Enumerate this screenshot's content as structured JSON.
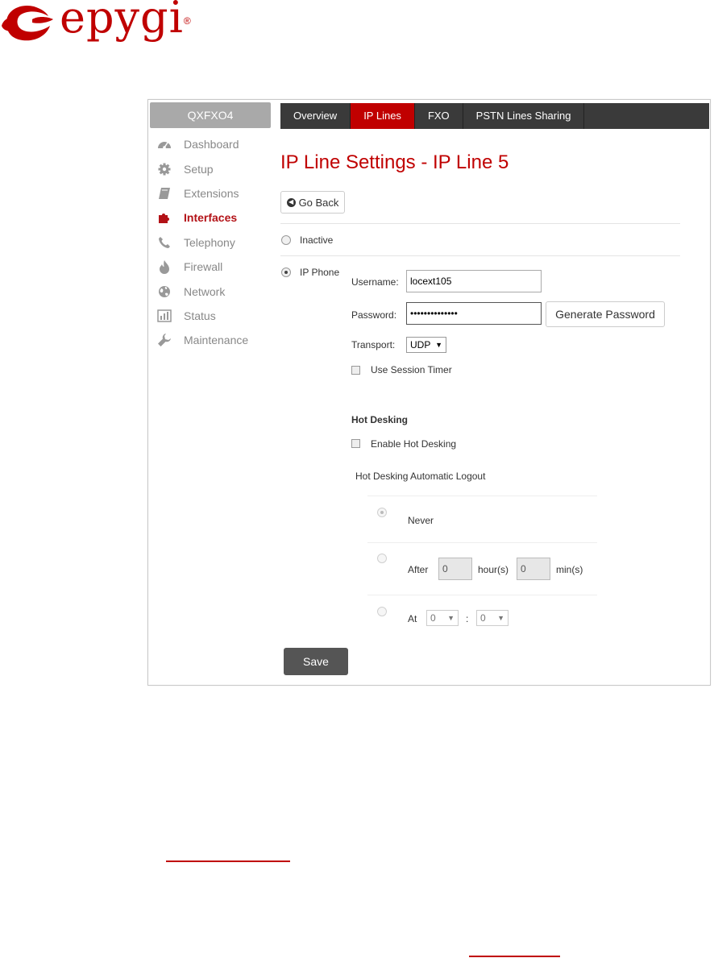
{
  "brand": {
    "name": "epygi",
    "reg": "®",
    "color": "#c00000"
  },
  "device": {
    "name": "QXFXO4"
  },
  "sidebar": {
    "items": [
      {
        "label": "Dashboard",
        "icon": "dashboard-icon"
      },
      {
        "label": "Setup",
        "icon": "gear-icon"
      },
      {
        "label": "Extensions",
        "icon": "book-icon"
      },
      {
        "label": "Interfaces",
        "icon": "puzzle-icon",
        "active": true
      },
      {
        "label": "Telephony",
        "icon": "phone-icon"
      },
      {
        "label": "Firewall",
        "icon": "flame-icon"
      },
      {
        "label": "Network",
        "icon": "globe-icon"
      },
      {
        "label": "Status",
        "icon": "bar-chart-icon"
      },
      {
        "label": "Maintenance",
        "icon": "wrench-icon"
      }
    ]
  },
  "tabs": [
    {
      "label": "Overview"
    },
    {
      "label": "IP Lines",
      "active": true
    },
    {
      "label": "FXO"
    },
    {
      "label": "PSTN Lines Sharing"
    }
  ],
  "page": {
    "title": "IP Line Settings - IP Line 5",
    "go_back": "Go Back"
  },
  "mode": {
    "inactive_label": "Inactive",
    "ip_phone_label": "IP Phone",
    "selected": "IP Phone"
  },
  "form": {
    "username_label": "Username:",
    "username_value": "locext105",
    "password_label": "Password:",
    "password_value": "••••••••••••••",
    "generate_password": "Generate Password",
    "transport_label": "Transport:",
    "transport_value": "UDP",
    "session_timer_label": "Use Session Timer"
  },
  "hot_desking": {
    "heading": "Hot Desking",
    "enable_label": "Enable Hot Desking",
    "logout_heading": "Hot Desking Automatic Logout",
    "never_label": "Never",
    "after_label": "After",
    "hours_value": "0",
    "hours_unit": "hour(s)",
    "mins_value": "0",
    "mins_unit": "min(s)",
    "at_label": "At",
    "at_hour": "0",
    "at_sep": ":",
    "at_min": "0",
    "selected": "Never"
  },
  "actions": {
    "save": "Save"
  }
}
